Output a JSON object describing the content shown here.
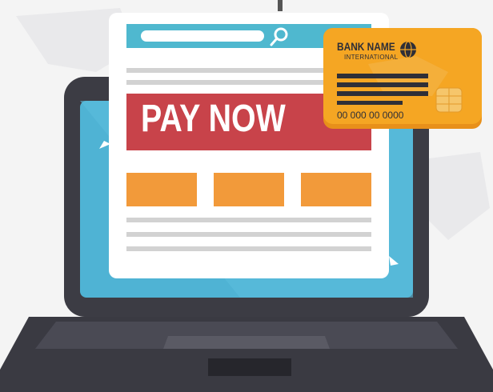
{
  "banner": {
    "label": "PAY NOW"
  },
  "card": {
    "bank_name": "BANK NAME",
    "bank_subtitle": "INTERNATIONAL",
    "number": "00 000 00 0000"
  },
  "icons": {
    "search": "search-icon",
    "globe": "globe-icon",
    "chip": "card-chip-icon",
    "cursor": "mouse-cursor-icon"
  },
  "colors": {
    "background": "#f4f4f4",
    "laptop_frame": "#3c3c44",
    "screen": "#4fb3d4",
    "page": "#ffffff",
    "search_bar": "#4fb8cf",
    "banner": "#c8434a",
    "orange_blocks": "#f29a3a",
    "text_lines": "#d2d2d2",
    "card": "#f5a623",
    "card_stripe": "#2f2f37"
  }
}
